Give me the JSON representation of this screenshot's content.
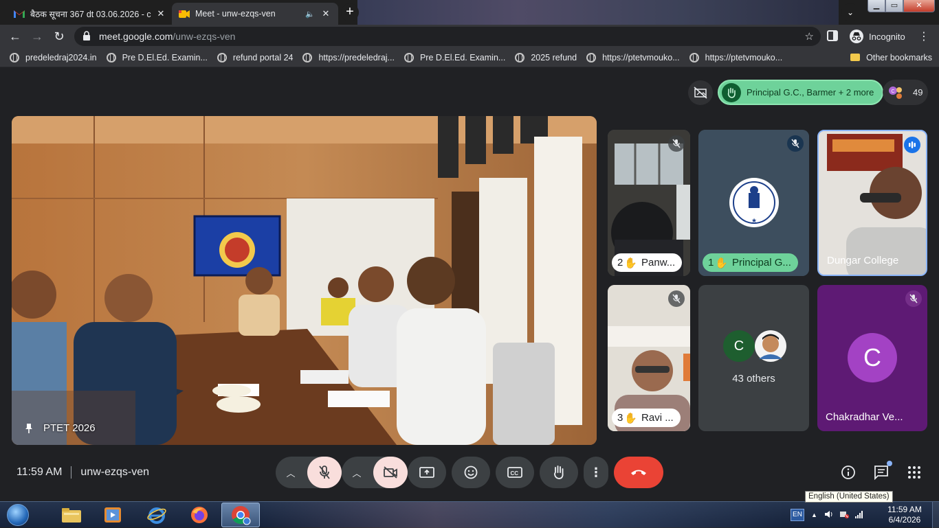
{
  "browser": {
    "tabs": [
      {
        "title": "बैठक सूचना 367 dt 03.06.2026 - c",
        "favicon": "gmail-icon"
      },
      {
        "title": "Meet - unw-ezqs-ven",
        "favicon": "meet-icon"
      }
    ],
    "new_tab_label": "+",
    "address": {
      "host": "meet.google.com",
      "path": "/unw-ezqs-ven"
    },
    "profile_label": "Incognito",
    "bookmarks": [
      "predeledraj2024.in",
      "Pre D.El.Ed. Examin...",
      "refund portal 24",
      "https://predeledraj...",
      "Pre D.El.Ed. Examin...",
      "2025 refund",
      "https://ptetvmouko...",
      "https://ptetvmouko..."
    ],
    "other_bookmarks": "Other bookmarks"
  },
  "meet": {
    "raised_hands_chip": "Principal G.C., Barmer + 2 more",
    "participant_count": "49",
    "main_tile": {
      "name": "PTET 2026"
    },
    "tiles": {
      "panw": {
        "hand_number": "2",
        "name": "Panw..."
      },
      "principal": {
        "hand_number": "1",
        "name": "Principal G...",
        "emblem_text": "राजकीय महाविद्यालय, बाड़मेर"
      },
      "dungar": {
        "name": "Dungar College"
      },
      "ravi": {
        "hand_number": "3",
        "name": "Ravi ..."
      },
      "others": {
        "avatar_letter": "C",
        "label": "43 others"
      },
      "chakradhar": {
        "avatar_letter": "C",
        "name": "Chakradhar Ve..."
      }
    },
    "time": "11:59 AM",
    "meeting_code": "unw-ezqs-ven",
    "colors": {
      "end_call": "#ea4335",
      "hand_raise": "#6ed29a",
      "active_speaker_border": "#8ab4f8",
      "mic_off_bg": "#f9dedc"
    }
  },
  "tooltip": "English (United States)",
  "taskbar": {
    "language": "EN",
    "clock_time": "11:59 AM",
    "clock_date": "6/4/2026"
  }
}
